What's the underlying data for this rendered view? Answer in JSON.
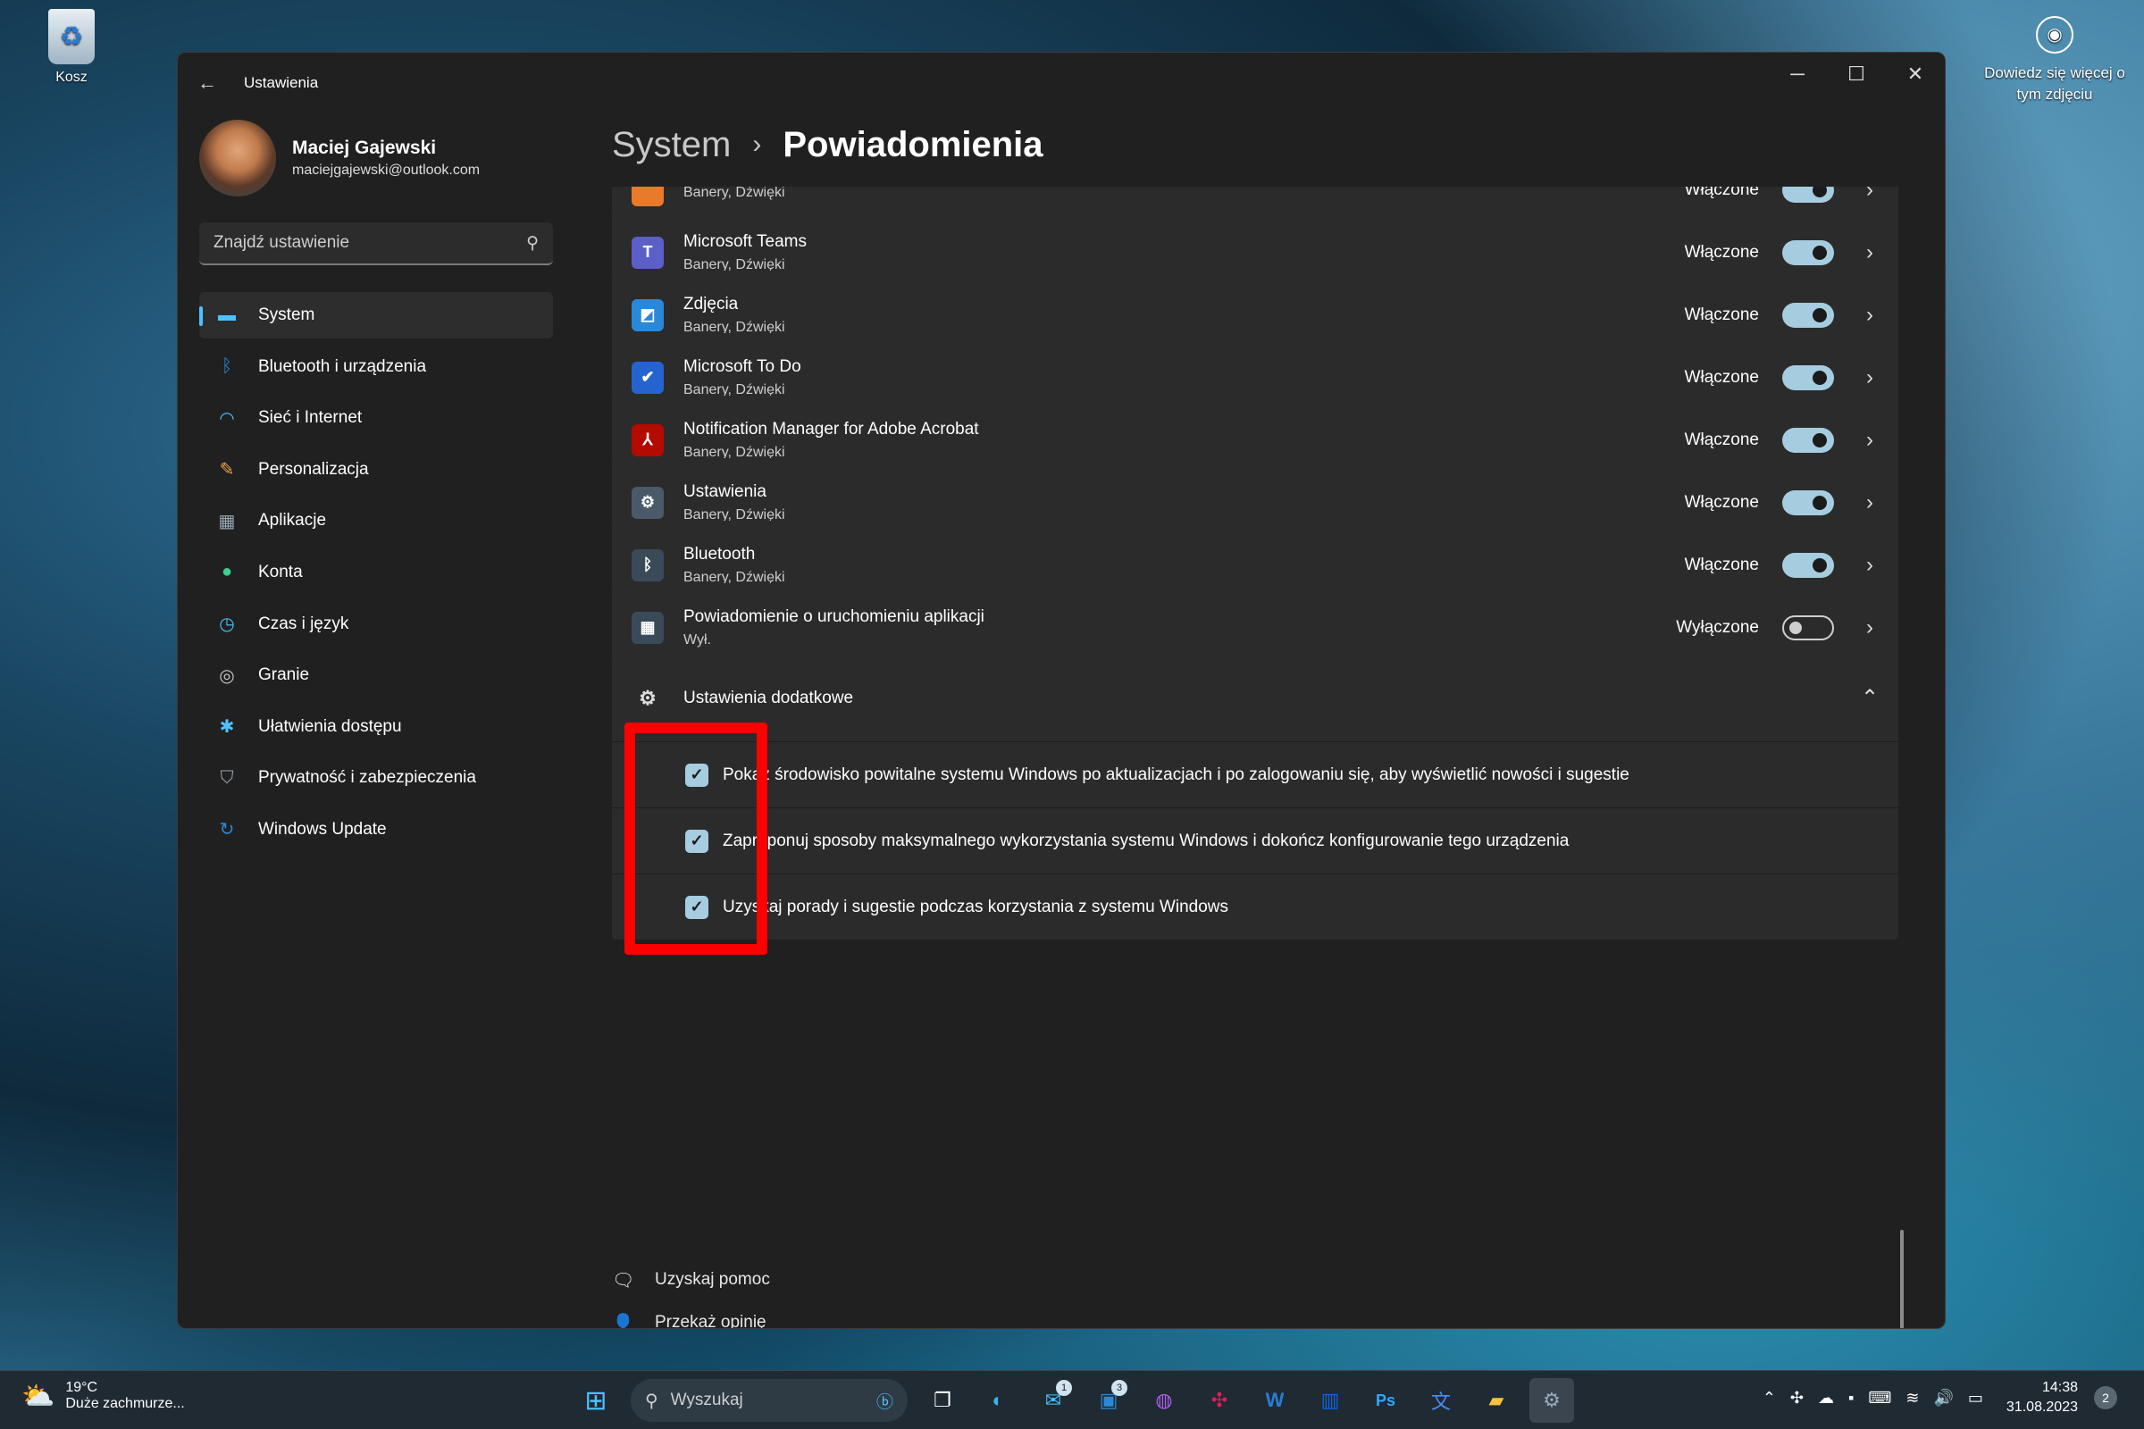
{
  "desktop": {
    "recycle_bin_label": "Kosz",
    "learn_more_label": "Dowiedz się więcej o tym zdjęciu"
  },
  "window": {
    "title": "Ustawienia",
    "caption_buttons": [
      "minimize-icon",
      "maximize-icon",
      "close-icon"
    ]
  },
  "profile": {
    "name": "Maciej Gajewski",
    "email": "maciejgajewski@outlook.com"
  },
  "search": {
    "placeholder": "Znajdź ustawienie"
  },
  "nav": [
    {
      "label": "System",
      "icon": "display-icon",
      "color": "#4cc2ff",
      "active": true
    },
    {
      "label": "Bluetooth i urządzenia",
      "icon": "bluetooth-icon",
      "color": "#2b88d8"
    },
    {
      "label": "Sieć i Internet",
      "icon": "wifi-icon",
      "color": "#4cc2ff"
    },
    {
      "label": "Personalizacja",
      "icon": "brush-icon",
      "color": "#e8a24a"
    },
    {
      "label": "Aplikacje",
      "icon": "apps-icon",
      "color": "#9aa7b3"
    },
    {
      "label": "Konta",
      "icon": "person-icon",
      "color": "#3ccf8e"
    },
    {
      "label": "Czas i język",
      "icon": "clock-globe-icon",
      "color": "#4cc2ff"
    },
    {
      "label": "Granie",
      "icon": "gamepad-icon",
      "color": "#c8c8c8"
    },
    {
      "label": "Ułatwienia dostępu",
      "icon": "accessibility-icon",
      "color": "#4cc2ff"
    },
    {
      "label": "Prywatność i zabezpieczenia",
      "icon": "shield-icon",
      "color": "#9aa7b3"
    },
    {
      "label": "Windows Update",
      "icon": "update-icon",
      "color": "#2b88d8"
    }
  ],
  "breadcrumb": {
    "parent": "System",
    "separator": "›",
    "current": "Powiadomienia"
  },
  "apps": [
    {
      "name": "",
      "sub": "Banery, Dźwięki",
      "state": "Włączone",
      "on": true,
      "icon": "app-icon",
      "color": "#e87a2b",
      "glyph": ""
    },
    {
      "name": "Microsoft Teams",
      "sub": "Banery, Dźwięki",
      "state": "Włączone",
      "on": true,
      "icon": "teams-icon",
      "color": "#5b5fc7",
      "glyph": "T"
    },
    {
      "name": "Zdjęcia",
      "sub": "Banery, Dźwięki",
      "state": "Włączone",
      "on": true,
      "icon": "photos-icon",
      "color": "#2b88d8",
      "glyph": "◩"
    },
    {
      "name": "Microsoft To Do",
      "sub": "Banery, Dźwięki",
      "state": "Włączone",
      "on": true,
      "icon": "todo-icon",
      "color": "#2564cf",
      "glyph": "✔"
    },
    {
      "name": "Notification Manager for Adobe Acrobat",
      "sub": "Banery, Dźwięki",
      "state": "Włączone",
      "on": true,
      "icon": "acrobat-icon",
      "color": "#b30b00",
      "glyph": "⅄"
    },
    {
      "name": "Ustawienia",
      "sub": "Banery, Dźwięki",
      "state": "Włączone",
      "on": true,
      "icon": "settings-gear-icon",
      "color": "#4a5a68",
      "glyph": "⚙"
    },
    {
      "name": "Bluetooth",
      "sub": "Banery, Dźwięki",
      "state": "Włączone",
      "on": true,
      "icon": "bluetooth-icon",
      "color": "#3a4a58",
      "glyph": "ᛒ"
    },
    {
      "name": "Powiadomienie o uruchomieniu aplikacji",
      "sub": "Wył.",
      "state": "Wyłączone",
      "on": false,
      "icon": "app-startup-icon",
      "color": "#3a4a58",
      "glyph": "▦"
    }
  ],
  "additional": {
    "title": "Ustawienia dodatkowe",
    "options": [
      {
        "label": "Pokaż środowisko powitalne systemu Windows po aktualizacjach i po zalogowaniu się, aby wyświetlić nowości i sugestie",
        "checked": true
      },
      {
        "label": "Zaproponuj sposoby maksymalnego wykorzystania systemu Windows i dokończ konfigurowanie tego urządzenia",
        "checked": true
      },
      {
        "label": "Uzyskaj porady i sugestie podczas korzystania z systemu Windows",
        "checked": true
      }
    ]
  },
  "links": [
    {
      "label": "Uzyskaj pomoc",
      "icon": "help-icon"
    },
    {
      "label": "Przekaż opinię",
      "icon": "feedback-icon"
    }
  ],
  "taskbar": {
    "weather_temp": "19°C",
    "weather_desc": "Duże zachmurze...",
    "search_placeholder": "Wyszukaj",
    "mail_badge": "1",
    "outlook_badge": "3",
    "time": "14:38",
    "date": "31.08.2023",
    "notifications": "2"
  }
}
